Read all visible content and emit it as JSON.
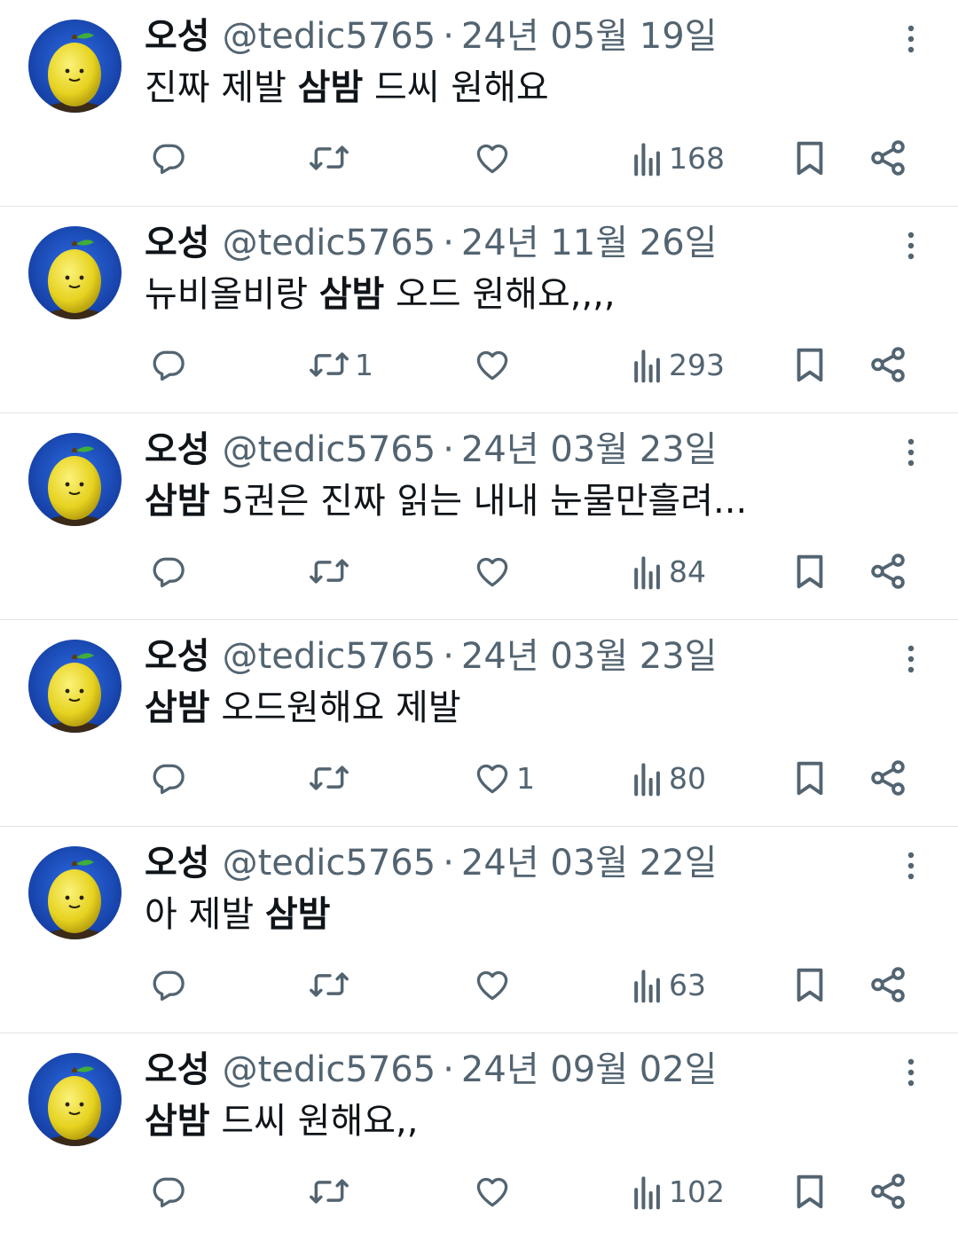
{
  "colors": {
    "text_primary": "#0f1419",
    "text_secondary": "#536471",
    "divider": "#e1e5e8",
    "avatar_bg": "#1a4fc4",
    "avatar_fruit": "#f2e33a"
  },
  "icons": {
    "avatar": "lemon-character-avatar",
    "more": "more-vertical-icon",
    "reply": "reply-bubble-icon",
    "retweet": "retweet-icon",
    "like": "heart-icon",
    "views": "views-bar-chart-icon",
    "bookmark": "bookmark-icon",
    "share": "share-icon"
  },
  "tweets": [
    {
      "name": "오성",
      "handle": "@tedic5765",
      "separator": "·",
      "date": "24년 05월 19일",
      "text_before": "진짜 제발 ",
      "text_bold": "삼밤",
      "text_after": " 드씨 원해요",
      "replies": "",
      "retweets": "",
      "likes": "",
      "views": "168"
    },
    {
      "name": "오성",
      "handle": "@tedic5765",
      "separator": "·",
      "date": "24년 11월 26일",
      "text_before": "뉴비올비랑 ",
      "text_bold": "삼밤",
      "text_after": " 오드 원해요,,,,",
      "replies": "",
      "retweets": "1",
      "likes": "",
      "views": "293"
    },
    {
      "name": "오성",
      "handle": "@tedic5765",
      "separator": "·",
      "date": "24년 03월 23일",
      "text_before": "",
      "text_bold": "삼밤",
      "text_after": " 5권은 진짜 읽는 내내 눈물만흘려...",
      "replies": "",
      "retweets": "",
      "likes": "",
      "views": "84"
    },
    {
      "name": "오성",
      "handle": "@tedic5765",
      "separator": "·",
      "date": "24년 03월 23일",
      "text_before": "",
      "text_bold": "삼밤",
      "text_after": " 오드원해요 제발",
      "replies": "",
      "retweets": "",
      "likes": "1",
      "views": "80"
    },
    {
      "name": "오성",
      "handle": "@tedic5765",
      "separator": "·",
      "date": "24년 03월 22일",
      "text_before": "아 제발 ",
      "text_bold": "삼밤",
      "text_after": "",
      "replies": "",
      "retweets": "",
      "likes": "",
      "views": "63"
    },
    {
      "name": "오성",
      "handle": "@tedic5765",
      "separator": "·",
      "date": "24년 09월 02일",
      "text_before": "",
      "text_bold": "삼밤",
      "text_after": " 드씨 원해요,,",
      "replies": "",
      "retweets": "",
      "likes": "",
      "views": "102"
    }
  ]
}
